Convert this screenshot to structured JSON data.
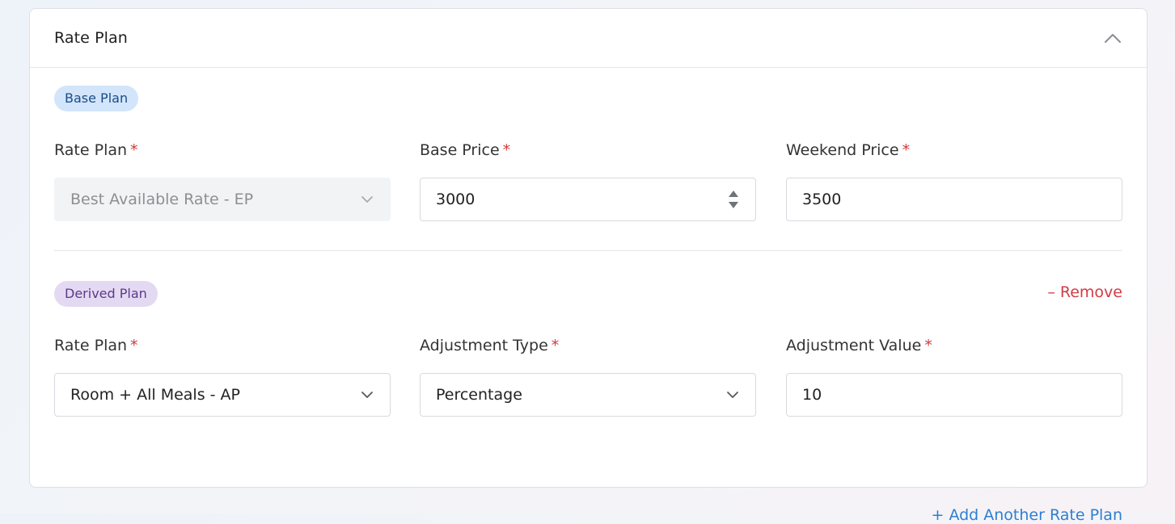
{
  "section": {
    "title": "Rate Plan",
    "collapse_icon": "chevron-up-icon"
  },
  "base_plan": {
    "badge": "Base Plan",
    "rate_plan": {
      "label": "Rate Plan",
      "required_mark": "*",
      "value": "Best Available Rate - EP"
    },
    "base_price": {
      "label": "Base Price",
      "required_mark": "*",
      "value": "3000"
    },
    "weekend_price": {
      "label": "Weekend Price",
      "required_mark": "*",
      "value": "3500"
    }
  },
  "derived_plan": {
    "badge": "Derived Plan",
    "remove_label": "– Remove",
    "rate_plan": {
      "label": "Rate Plan",
      "required_mark": "*",
      "value": "Room + All Meals - AP"
    },
    "adjustment_type": {
      "label": "Adjustment Type",
      "required_mark": "*",
      "value": "Percentage"
    },
    "adjustment_value": {
      "label": "Adjustment Value",
      "required_mark": "*",
      "value": "10"
    }
  },
  "add_another_label": "+ Add Another Rate Plan",
  "colors": {
    "accent_blue": "#2d7fd1",
    "remove_red": "#d13b45",
    "required_red": "#d23a3a",
    "base_badge_bg": "#d2e5fb",
    "derived_badge_bg": "#e4d9f3"
  }
}
